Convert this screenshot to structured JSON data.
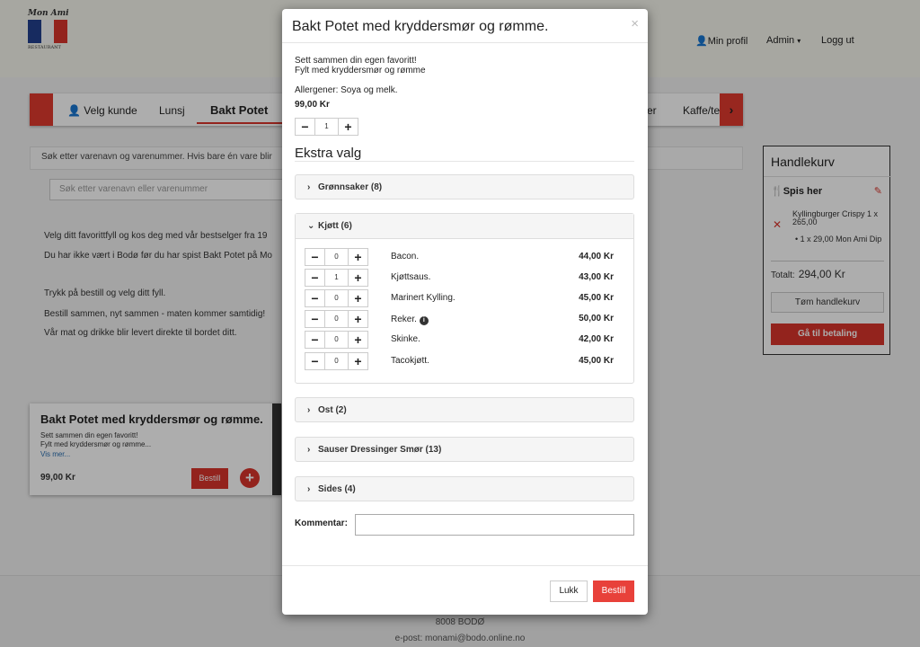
{
  "header": {
    "logo_text": "Mon Ami",
    "logo_sub": "RESTAURANT",
    "nav": [
      "Min profil",
      "Admin",
      "Logg ut"
    ]
  },
  "categories": [
    "Velg kunde",
    "Lunsj",
    "Bakt Potet",
    "er",
    "Kaffe/te"
  ],
  "search": {
    "hint": "Søk etter varenavn og varenummer. Hvis bare én vare blir",
    "placeholder": "Søk etter varenavn eller varenummer"
  },
  "intro": [
    "Velg ditt favorittfyll og kos deg med vår bestselger fra 19",
    "Du har ikke vært i Bodø før du har spist Bakt Potet på Mo",
    "Trykk på bestill og velg ditt fyll.",
    "Bestill sammen, nyt sammen - maten kommer samtidig!",
    "Vår mat og drikke blir levert direkte til bordet ditt."
  ],
  "product_card": {
    "title": "Bakt Potet med kryddersmør og rømme.",
    "desc1": "Sett sammen din egen favoritt!",
    "desc2": "Fylt med kryddersmør og rømme...",
    "more": "Vis mer...",
    "price": "99,00 Kr",
    "order_label": "Bestill",
    "add_label": "+"
  },
  "cart": {
    "title": "Handlekurv",
    "dine_label": "Spis her",
    "item": "Kyllingburger Crispy 1 x 265,00",
    "sub_item": "1 x 29,00 Mon Ami Dip",
    "remove": "✕",
    "total_label": "Totalt:",
    "total_value": "294,00 Kr",
    "empty_label": "Tøm handlekurv",
    "checkout_label": "Gå til betaling"
  },
  "footer": {
    "city": "8008 BODØ",
    "email": "e-post: monami@bodo.online.no"
  },
  "modal": {
    "title": "Bakt Potet med kryddersmør og rømme.",
    "close": "×",
    "desc1": "Sett sammen din egen favoritt!",
    "desc2": "Fylt med kryddersmør og rømme",
    "allergens": "Allergener: Soya og melk.",
    "price": "99,00 Kr",
    "quantity": "1",
    "minus": "−",
    "plus": "+",
    "extras_title": "Ekstra valg",
    "groups": {
      "gronnsaker": "Grønnsaker (8)",
      "kjott": "Kjøtt (6)",
      "ost": "Ost (2)",
      "sauser": "Sauser Dressinger Smør (13)",
      "sides": "Sides (4)"
    },
    "kjott_items": [
      {
        "name": "Bacon.",
        "qty": "0",
        "price": "44,00 Kr"
      },
      {
        "name": "Kjøttsaus.",
        "qty": "1",
        "price": "43,00 Kr"
      },
      {
        "name": "Marinert Kylling.",
        "qty": "0",
        "price": "45,00 Kr"
      },
      {
        "name": "Reker.",
        "qty": "0",
        "price": "50,00 Kr",
        "info": "i"
      },
      {
        "name": "Skinke.",
        "qty": "0",
        "price": "42,00 Kr"
      },
      {
        "name": "Tacokjøtt.",
        "qty": "0",
        "price": "45,00 Kr"
      }
    ],
    "comment_label": "Kommentar:",
    "close_label": "Lukk",
    "order_label": "Bestill"
  },
  "colors": {
    "accent": "#e8413a",
    "brand_red": "#d9342b"
  }
}
